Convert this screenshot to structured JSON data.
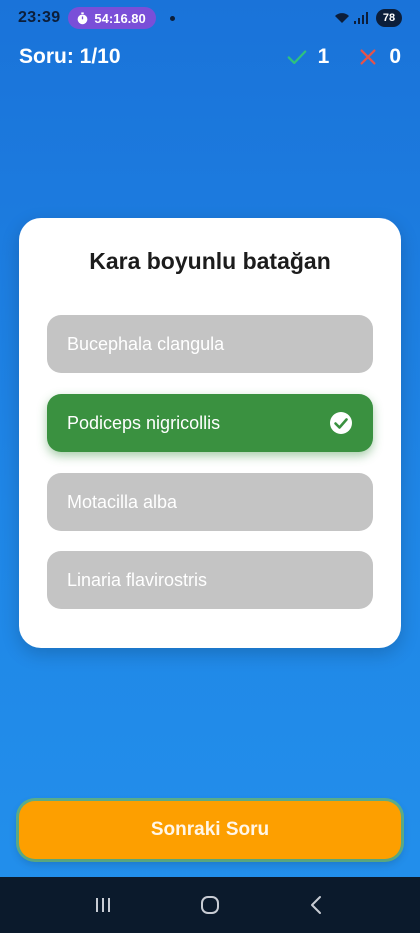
{
  "status_bar": {
    "time": "23:39",
    "timer": "54:16.80",
    "battery": "78"
  },
  "header": {
    "question_counter": "Soru: 1/10",
    "correct_count": "1",
    "wrong_count": "0"
  },
  "question": {
    "title": "Kara boyunlu batağan",
    "options": [
      {
        "label": "Bucephala clangula",
        "state": "neutral"
      },
      {
        "label": "Podiceps nigricollis",
        "state": "correct"
      },
      {
        "label": "Motacilla alba",
        "state": "neutral"
      },
      {
        "label": "Linaria flavirostris",
        "state": "neutral"
      }
    ]
  },
  "next_button": {
    "label": "Sonraki Soru"
  },
  "colors": {
    "background": "#1f86e6",
    "correct": "#3a9140",
    "neutral_option": "#c4c4c4",
    "next_button": "#fd9f00",
    "check_icon": "#2ec27e",
    "wrong_icon": "#e5534b"
  },
  "icons": {
    "timer": "stopwatch-icon",
    "correct": "checkmark-icon",
    "wrong": "x-icon",
    "selected": "check-circle-icon",
    "nav": [
      "recents-icon",
      "home-icon",
      "back-icon"
    ]
  }
}
